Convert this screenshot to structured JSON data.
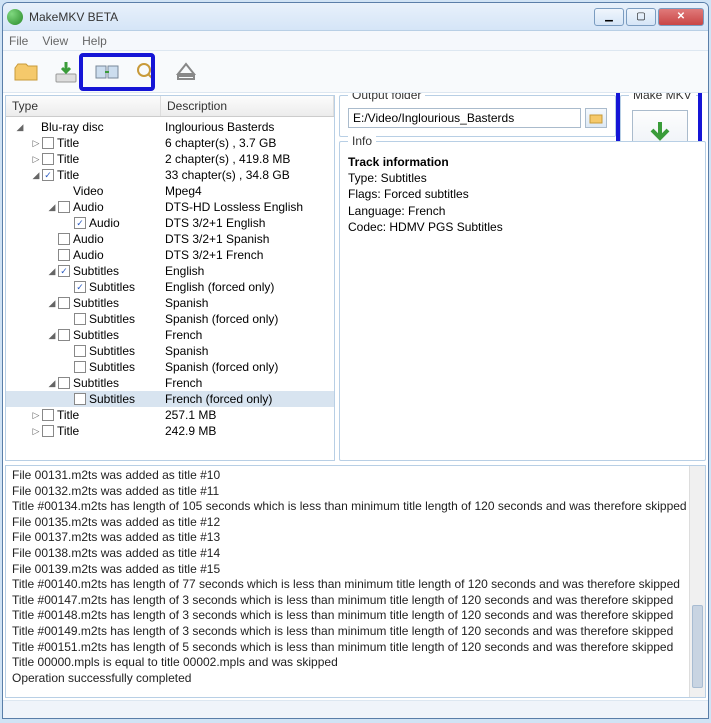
{
  "window": {
    "title": "MakeMKV BETA"
  },
  "menu": {
    "file": "File",
    "view": "View",
    "help": "Help"
  },
  "toolbar_icons": [
    "folder-open-icon",
    "disc-to-hdd-icon",
    "stream-icon",
    "search-icon",
    "eject-icon"
  ],
  "tree_headers": {
    "type": "Type",
    "description": "Description"
  },
  "tree": [
    {
      "lvl": 0,
      "exp": "open",
      "chk": null,
      "label": "Blu-ray disc",
      "desc": "Inglourious Basterds"
    },
    {
      "lvl": 1,
      "exp": "closed",
      "chk": false,
      "label": "Title",
      "desc": "6 chapter(s) , 3.7 GB"
    },
    {
      "lvl": 1,
      "exp": "closed",
      "chk": false,
      "label": "Title",
      "desc": "2 chapter(s) , 419.8 MB"
    },
    {
      "lvl": 1,
      "exp": "open",
      "chk": true,
      "label": "Title",
      "desc": "33 chapter(s) , 34.8 GB"
    },
    {
      "lvl": 2,
      "exp": "none",
      "chk": null,
      "label": "Video",
      "desc": "Mpeg4"
    },
    {
      "lvl": 2,
      "exp": "open",
      "chk": false,
      "label": "Audio",
      "desc": "DTS-HD Lossless English"
    },
    {
      "lvl": 3,
      "exp": "none",
      "chk": true,
      "label": "Audio",
      "desc": "DTS 3/2+1 English"
    },
    {
      "lvl": 2,
      "exp": "none",
      "chk": false,
      "label": "Audio",
      "desc": "DTS 3/2+1 Spanish"
    },
    {
      "lvl": 2,
      "exp": "none",
      "chk": false,
      "label": "Audio",
      "desc": "DTS 3/2+1 French"
    },
    {
      "lvl": 2,
      "exp": "open",
      "chk": true,
      "label": "Subtitles",
      "desc": "English"
    },
    {
      "lvl": 3,
      "exp": "none",
      "chk": true,
      "label": "Subtitles",
      "desc": "English  (forced only)"
    },
    {
      "lvl": 2,
      "exp": "open",
      "chk": false,
      "label": "Subtitles",
      "desc": "Spanish"
    },
    {
      "lvl": 3,
      "exp": "none",
      "chk": false,
      "label": "Subtitles",
      "desc": "Spanish  (forced only)"
    },
    {
      "lvl": 2,
      "exp": "open",
      "chk": false,
      "label": "Subtitles",
      "desc": "French"
    },
    {
      "lvl": 3,
      "exp": "none",
      "chk": false,
      "label": "Subtitles",
      "desc": "Spanish"
    },
    {
      "lvl": 3,
      "exp": "none",
      "chk": false,
      "label": "Subtitles",
      "desc": "Spanish  (forced only)"
    },
    {
      "lvl": 2,
      "exp": "open",
      "chk": false,
      "label": "Subtitles",
      "desc": "French",
      "sel": false
    },
    {
      "lvl": 3,
      "exp": "none",
      "chk": false,
      "label": "Subtitles",
      "desc": "French  (forced only)",
      "sel": true
    },
    {
      "lvl": 1,
      "exp": "closed",
      "chk": false,
      "label": "Title",
      "desc": "257.1 MB"
    },
    {
      "lvl": 1,
      "exp": "closed",
      "chk": false,
      "label": "Title",
      "desc": "242.9 MB"
    }
  ],
  "output": {
    "label": "Output folder",
    "value": "E:/Video/Inglourious_Basterds"
  },
  "makemkv": {
    "label": "Make MKV"
  },
  "info": {
    "label": "Info",
    "header": "Track information",
    "lines": [
      "Type: Subtitles",
      "Flags: Forced subtitles",
      "Language: French",
      "Codec: HDMV PGS Subtitles"
    ]
  },
  "log": [
    "File 00131.m2ts was added as title #10",
    "File 00132.m2ts was added as title #11",
    "Title #00134.m2ts has length of 105 seconds which is less than minimum title length of 120 seconds and was therefore skipped",
    "File 00135.m2ts was added as title #12",
    "File 00137.m2ts was added as title #13",
    "File 00138.m2ts was added as title #14",
    "File 00139.m2ts was added as title #15",
    "Title #00140.m2ts has length of 77 seconds which is less than minimum title length of 120 seconds and was therefore skipped",
    "Title #00147.m2ts has length of 3 seconds which is less than minimum title length of 120 seconds and was therefore skipped",
    "Title #00148.m2ts has length of 3 seconds which is less than minimum title length of 120 seconds and was therefore skipped",
    "Title #00149.m2ts has length of 3 seconds which is less than minimum title length of 120 seconds and was therefore skipped",
    "Title #00151.m2ts has length of 5 seconds which is less than minimum title length of 120 seconds and was therefore skipped",
    "Title 00000.mpls is equal to title 00002.mpls and was skipped",
    "Operation successfully completed"
  ]
}
